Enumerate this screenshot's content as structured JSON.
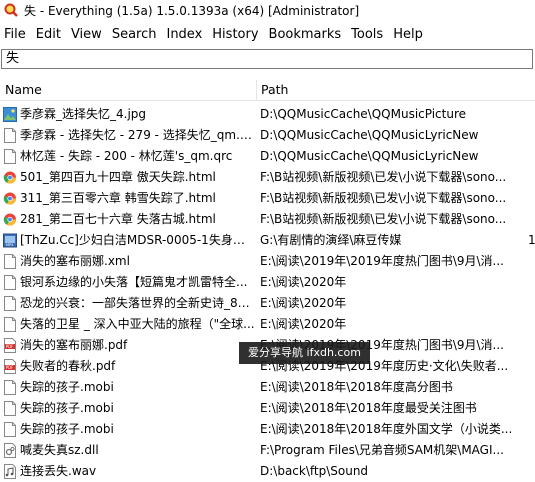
{
  "window": {
    "title": "失 - Everything (1.5a) 1.5.0.1393a (x64) [Administrator]"
  },
  "menu": [
    "File",
    "Edit",
    "View",
    "Search",
    "Index",
    "History",
    "Bookmarks",
    "Tools",
    "Help"
  ],
  "search": {
    "value": "失"
  },
  "columns": {
    "name": "Name",
    "path": "Path"
  },
  "rows": [
    {
      "icon": "image-file-icon",
      "name": "季彦霖_选择失忆_4.jpg",
      "path": "D:\\QQMusicCache\\QQMusicPicture"
    },
    {
      "icon": "document-file-icon",
      "name": "季彦霖 - 选择失忆 - 279 - 选择失忆_qm.qrc",
      "path": "D:\\QQMusicCache\\QQMusicLyricNew"
    },
    {
      "icon": "document-file-icon",
      "name": "林忆莲 - 失踪 - 200 - 林忆莲's_qm.qrc",
      "path": "D:\\QQMusicCache\\QQMusicLyricNew"
    },
    {
      "icon": "chrome-html-icon",
      "name": "501_第四百九十四章 傲天失踪.html",
      "path": "F:\\B站视频\\新版视频\\已发\\小说下载器\\sono..."
    },
    {
      "icon": "chrome-html-icon",
      "name": "311_第三百零六章 韩雪失踪了.html",
      "path": "F:\\B站视频\\新版视频\\已发\\小说下载器\\sono..."
    },
    {
      "icon": "chrome-html-icon",
      "name": "281_第二百七十六章 失落古城.html",
      "path": "F:\\B站视频\\新版视频\\已发\\小说下载器\\sono..."
    },
    {
      "icon": "video-file-icon",
      "name": "[ThZu.Cc]少妇白洁MDSR-0005-1失身的...",
      "path": "G:\\有剧情的演绎\\麻豆传媒",
      "extra": "1"
    },
    {
      "icon": "document-file-icon",
      "name": "消失的塞布丽娜.xml",
      "path": "E:\\阅读\\2019年\\2019年度热门图书\\9月\\消..."
    },
    {
      "icon": "document-file-icon",
      "name": "银河系边缘的小失落【短篇鬼才凯雷特全...",
      "path": "E:\\阅读\\2020年"
    },
    {
      "icon": "document-file-icon",
      "name": "恐龙的兴衰：一部失落世界的全新史诗_88...",
      "path": "E:\\阅读\\2020年"
    },
    {
      "icon": "document-file-icon",
      "name": "失落的卫星 _ 深入中亚大陆的旅程（\"全球...",
      "path": "E:\\阅读\\2020年"
    },
    {
      "icon": "pdf-file-icon",
      "name": "消失的塞布丽娜.pdf",
      "path": "E:\\阅读\\2019年\\2019年度热门图书\\9月\\消..."
    },
    {
      "icon": "pdf-file-icon",
      "name": "失败者的春秋.pdf",
      "path": "E:\\阅读\\2019年\\2019年度历史·文化\\失败者..."
    },
    {
      "icon": "document-file-icon",
      "name": "失踪的孩子.mobi",
      "path": "E:\\阅读\\2018年\\2018年度高分图书"
    },
    {
      "icon": "document-file-icon",
      "name": "失踪的孩子.mobi",
      "path": "E:\\阅读\\2018年\\2018年度最受关注图书"
    },
    {
      "icon": "document-file-icon",
      "name": "失踪的孩子.mobi",
      "path": "E:\\阅读\\2018年\\2018年度外国文学（小说类..."
    },
    {
      "icon": "dll-file-icon",
      "name": "喊麦失真sz.dll",
      "path": "F:\\Program Files\\兄弟音频SAM机架\\MAGI..."
    },
    {
      "icon": "audio-file-icon",
      "name": "连接丢失.wav",
      "path": "D:\\back\\ftp\\Sound"
    }
  ],
  "watermark": "爱分享导航 ifxdh.com"
}
